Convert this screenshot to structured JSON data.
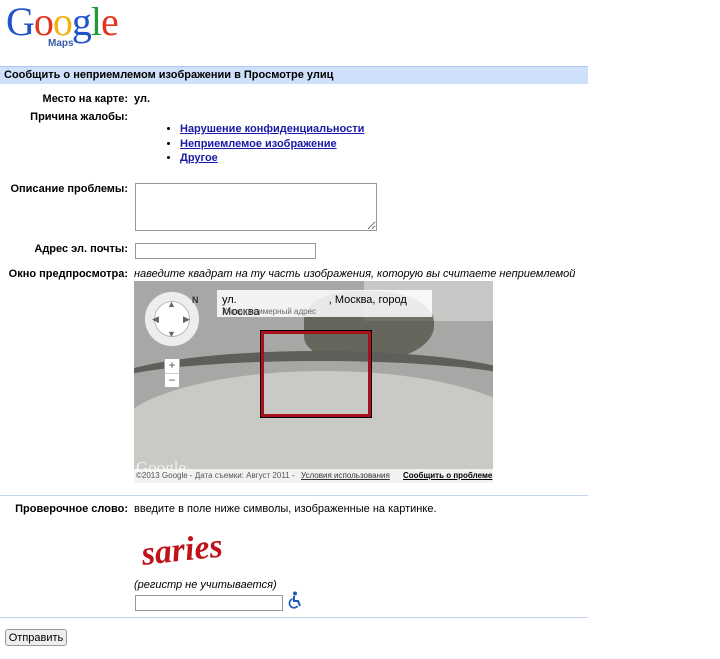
{
  "logo": {
    "brand": "Google",
    "product": "Maps"
  },
  "title": "Сообщить о неприемлемом изображении в Просмотре улиц",
  "form": {
    "location_label": "Место на карте:",
    "location_value": "ул.",
    "reason_label": "Причина жалобы:",
    "reasons": [
      "Нарушение конфиденциальности",
      "Неприемлемое изображение",
      "Другое"
    ],
    "description_label": "Описание проблемы:",
    "email_label": "Адрес эл. почты:",
    "preview_label": "Окно предпросмотра:",
    "preview_hint": "наведите квадрат на ту часть изображения, которую вы считаете неприемлемой"
  },
  "preview": {
    "address_line1_part1": "ул.",
    "address_line1_part2": ", Москва, город Москва",
    "address_line2": "Указан примерный адрес",
    "compass_label": "N",
    "zoom_in": "+",
    "zoom_out": "−",
    "watermark": "Google",
    "copyright": "©2013 Google - Дата съемки: Август 2011 -",
    "terms_link": "Условия использования",
    "report_link": "Сообщить о проблеме"
  },
  "captcha": {
    "label": "Проверочное слово:",
    "hint": "введите в поле ниже символы, изображенные на картинке.",
    "word": "saries",
    "note": "(регистр не учитывается)"
  },
  "submit_label": "Отправить"
}
